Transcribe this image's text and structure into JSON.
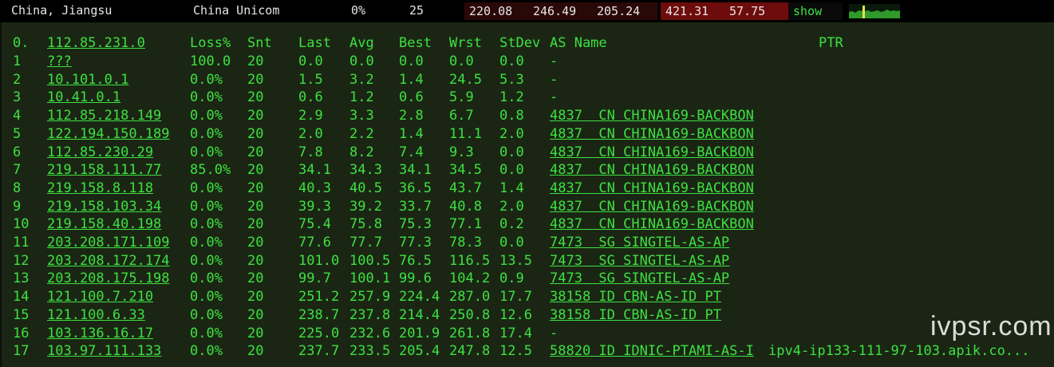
{
  "topbar": {
    "location": "China, Jiangsu",
    "isp": "China Unicom",
    "loss": "0%",
    "count": "25",
    "v1": "220.08",
    "v2": "246.49",
    "v3": "205.24",
    "v4": "421.31",
    "v5": "57.75",
    "show_label": "show"
  },
  "header": {
    "hop0": "0.",
    "target": "112.85.231.0",
    "loss": "Loss%",
    "snt": "Snt",
    "last": "Last",
    "avg": "Avg",
    "best": "Best",
    "wrst": "Wrst",
    "stdev": "StDev",
    "asname": "AS Name",
    "ptr": "PTR"
  },
  "hops": [
    {
      "n": "1",
      "ip": "???",
      "loss": "100.0",
      "snt": "20",
      "last": "0.0",
      "avg": "0.0",
      "best": "0.0",
      "wrst": "0.0",
      "stdev": "0.0",
      "as": "-",
      "ptr": ""
    },
    {
      "n": "2",
      "ip": "10.101.0.1",
      "loss": "0.0%",
      "snt": "20",
      "last": "1.5",
      "avg": "3.2",
      "best": "1.4",
      "wrst": "24.5",
      "stdev": "5.3",
      "as": "-",
      "ptr": ""
    },
    {
      "n": "3",
      "ip": "10.41.0.1",
      "loss": "0.0%",
      "snt": "20",
      "last": "0.6",
      "avg": "1.2",
      "best": "0.6",
      "wrst": "5.9",
      "stdev": "1.2",
      "as": "-",
      "ptr": ""
    },
    {
      "n": "4",
      "ip": "112.85.218.149",
      "loss": "0.0%",
      "snt": "20",
      "last": "2.9",
      "avg": "3.3",
      "best": "2.8",
      "wrst": "6.7",
      "stdev": "0.8",
      "as": "4837  CN CHINA169-BACKBON",
      "ptr": ""
    },
    {
      "n": "5",
      "ip": "122.194.150.189",
      "loss": "0.0%",
      "snt": "20",
      "last": "2.0",
      "avg": "2.2",
      "best": "1.4",
      "wrst": "11.1",
      "stdev": "2.0",
      "as": "4837  CN CHINA169-BACKBON",
      "ptr": ""
    },
    {
      "n": "6",
      "ip": "112.85.230.29",
      "loss": "0.0%",
      "snt": "20",
      "last": "7.8",
      "avg": "8.2",
      "best": "7.4",
      "wrst": "9.3",
      "stdev": "0.0",
      "as": "4837  CN CHINA169-BACKBON",
      "ptr": ""
    },
    {
      "n": "7",
      "ip": "219.158.111.77",
      "loss": "85.0%",
      "snt": "20",
      "last": "34.1",
      "avg": "34.3",
      "best": "34.1",
      "wrst": "34.5",
      "stdev": "0.0",
      "as": "4837  CN CHINA169-BACKBON",
      "ptr": ""
    },
    {
      "n": "8",
      "ip": "219.158.8.118",
      "loss": "0.0%",
      "snt": "20",
      "last": "40.3",
      "avg": "40.5",
      "best": "36.5",
      "wrst": "43.7",
      "stdev": "1.4",
      "as": "4837  CN CHINA169-BACKBON",
      "ptr": ""
    },
    {
      "n": "9",
      "ip": "219.158.103.34",
      "loss": "0.0%",
      "snt": "20",
      "last": "39.3",
      "avg": "39.2",
      "best": "33.7",
      "wrst": "40.8",
      "stdev": "2.0",
      "as": "4837  CN CHINA169-BACKBON",
      "ptr": ""
    },
    {
      "n": "10",
      "ip": "219.158.40.198",
      "loss": "0.0%",
      "snt": "20",
      "last": "75.4",
      "avg": "75.8",
      "best": "75.3",
      "wrst": "77.1",
      "stdev": "0.2",
      "as": "4837  CN CHINA169-BACKBON",
      "ptr": ""
    },
    {
      "n": "11",
      "ip": "203.208.171.109",
      "loss": "0.0%",
      "snt": "20",
      "last": "77.6",
      "avg": "77.7",
      "best": "77.3",
      "wrst": "78.3",
      "stdev": "0.0",
      "as": "7473  SG SINGTEL-AS-AP",
      "ptr": ""
    },
    {
      "n": "12",
      "ip": "203.208.172.174",
      "loss": "0.0%",
      "snt": "20",
      "last": "101.0",
      "avg": "100.5",
      "best": "76.5",
      "wrst": "116.5",
      "stdev": "13.5",
      "as": "7473  SG SINGTEL-AS-AP",
      "ptr": ""
    },
    {
      "n": "13",
      "ip": "203.208.175.198",
      "loss": "0.0%",
      "snt": "20",
      "last": "99.7",
      "avg": "100.1",
      "best": "99.6",
      "wrst": "104.2",
      "stdev": "0.9",
      "as": "7473  SG SINGTEL-AS-AP",
      "ptr": ""
    },
    {
      "n": "14",
      "ip": "121.100.7.210",
      "loss": "0.0%",
      "snt": "20",
      "last": "251.2",
      "avg": "257.9",
      "best": "224.4",
      "wrst": "287.0",
      "stdev": "17.7",
      "as": "38158 ID CBN-AS-ID PT",
      "ptr": ""
    },
    {
      "n": "15",
      "ip": "121.100.6.33",
      "loss": "0.0%",
      "snt": "20",
      "last": "238.7",
      "avg": "237.8",
      "best": "214.4",
      "wrst": "250.8",
      "stdev": "12.6",
      "as": "38158 ID CBN-AS-ID PT",
      "ptr": ""
    },
    {
      "n": "16",
      "ip": "103.136.16.17",
      "loss": "0.0%",
      "snt": "20",
      "last": "225.0",
      "avg": "232.6",
      "best": "201.9",
      "wrst": "261.8",
      "stdev": "17.4",
      "as": "-",
      "ptr": ""
    },
    {
      "n": "17",
      "ip": "103.97.111.133",
      "loss": "0.0%",
      "snt": "20",
      "last": "237.7",
      "avg": "233.5",
      "best": "205.4",
      "wrst": "247.8",
      "stdev": "12.5",
      "as": "58820 ID IDNIC-PTAMI-AS-I",
      "ptr": "ipv4-ip133-111-97-103.apik.co..."
    }
  ],
  "watermark": "ivpsr.com",
  "colors": {
    "text_green": "#3ee042",
    "panel_bg": "#1a2613",
    "box_dark_red": "#3a0a0a",
    "box_red": "#6b0e0e"
  }
}
